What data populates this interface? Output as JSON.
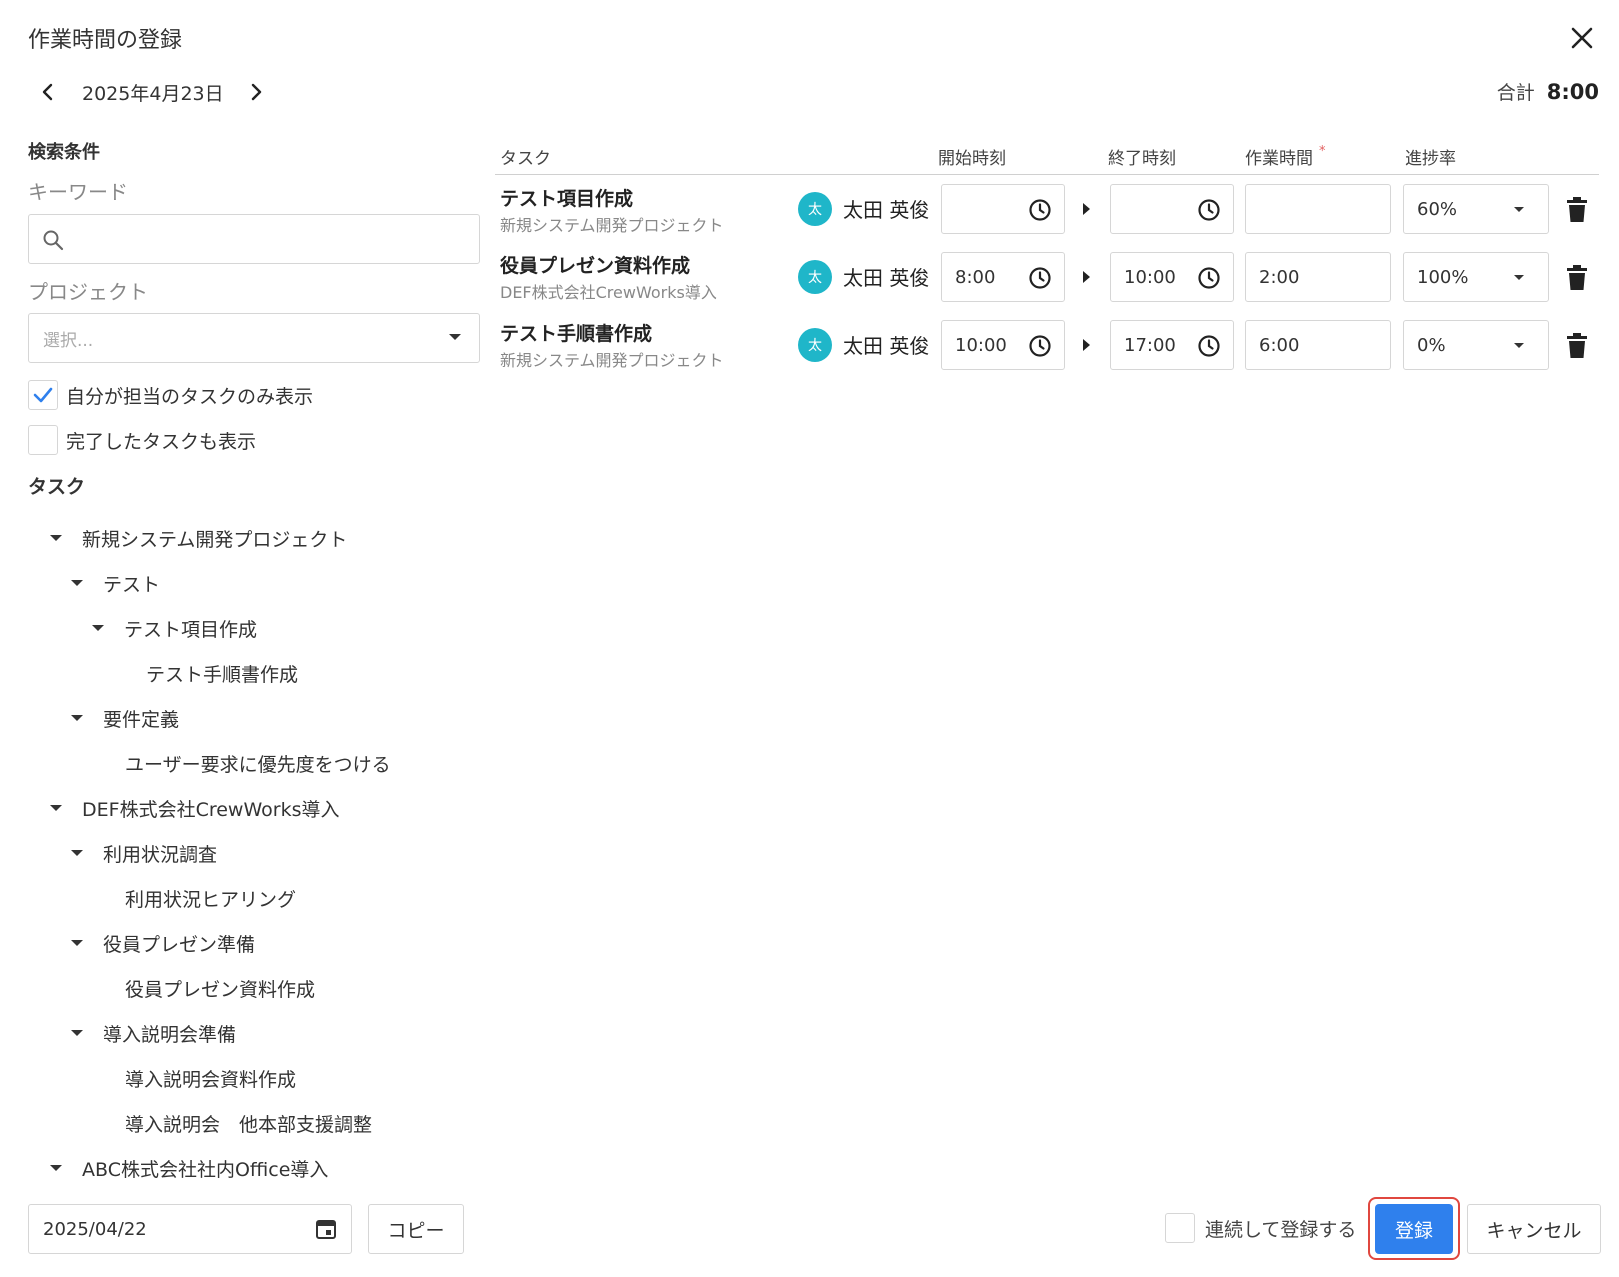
{
  "dialog": {
    "title": "作業時間の登録",
    "date": "2025年4月23日",
    "total_label": "合計",
    "total_value": "8:00"
  },
  "search": {
    "section_title": "検索条件",
    "keyword_label": "キーワード",
    "keyword_value": "",
    "project_label": "プロジェクト",
    "project_placeholder": "選択...",
    "only_mine_label": "自分が担当のタスクのみ表示",
    "only_mine_checked": true,
    "show_done_label": "完了したタスクも表示",
    "show_done_checked": false
  },
  "tree": {
    "section_title": "タスク",
    "items": [
      {
        "label": "新規システム開発プロジェクト",
        "level": 0,
        "expanded": true
      },
      {
        "label": "テスト",
        "level": 1,
        "expanded": true
      },
      {
        "label": "テスト項目作成",
        "level": 2,
        "expanded": true
      },
      {
        "label": "テスト手順書作成",
        "level": 3,
        "expanded": false
      },
      {
        "label": "要件定義",
        "level": 1,
        "expanded": true
      },
      {
        "label": "ユーザー要求に優先度をつける",
        "level": 2,
        "expanded": false
      },
      {
        "label": "DEF株式会社CrewWorks導入",
        "level": 0,
        "expanded": true
      },
      {
        "label": "利用状況調査",
        "level": 1,
        "expanded": true
      },
      {
        "label": "利用状況ヒアリング",
        "level": 2,
        "expanded": false
      },
      {
        "label": "役員プレゼン準備",
        "level": 1,
        "expanded": true
      },
      {
        "label": "役員プレゼン資料作成",
        "level": 2,
        "expanded": false
      },
      {
        "label": "導入説明会準備",
        "level": 1,
        "expanded": true
      },
      {
        "label": "導入説明会資料作成",
        "level": 2,
        "expanded": false
      },
      {
        "label": "導入説明会　他本部支援調整",
        "level": 2,
        "expanded": false
      },
      {
        "label": "ABC株式会社社内Office導入",
        "level": 0,
        "expanded": true
      }
    ]
  },
  "table": {
    "headers": {
      "task": "タスク",
      "start": "開始時刻",
      "end": "終了時刻",
      "duration": "作業時間",
      "progress": "進捗率"
    },
    "rows": [
      {
        "task": "テスト項目作成",
        "project": "新規システム開発プロジェクト",
        "avatar": "太",
        "user": "太田 英俊",
        "start": "",
        "end": "",
        "duration": "",
        "progress": "60%"
      },
      {
        "task": "役員プレゼン資料作成",
        "project": "DEF株式会社CrewWorks導入",
        "avatar": "太",
        "user": "太田 英俊",
        "start": "8:00",
        "end": "10:00",
        "duration": "2:00",
        "progress": "100%"
      },
      {
        "task": "テスト手順書作成",
        "project": "新規システム開発プロジェクト",
        "avatar": "太",
        "user": "太田 英俊",
        "start": "10:00",
        "end": "17:00",
        "duration": "6:00",
        "progress": "0%"
      }
    ]
  },
  "footer": {
    "copy_date": "2025/04/22",
    "copy_label": "コピー",
    "continuous_label": "連続して登録する",
    "continuous_checked": false,
    "register_label": "登録",
    "cancel_label": "キャンセル"
  },
  "colors": {
    "accent": "#2f80ed",
    "avatar": "#1fb6c9",
    "highlight": "#e0473f",
    "check": "#2f80ed"
  }
}
